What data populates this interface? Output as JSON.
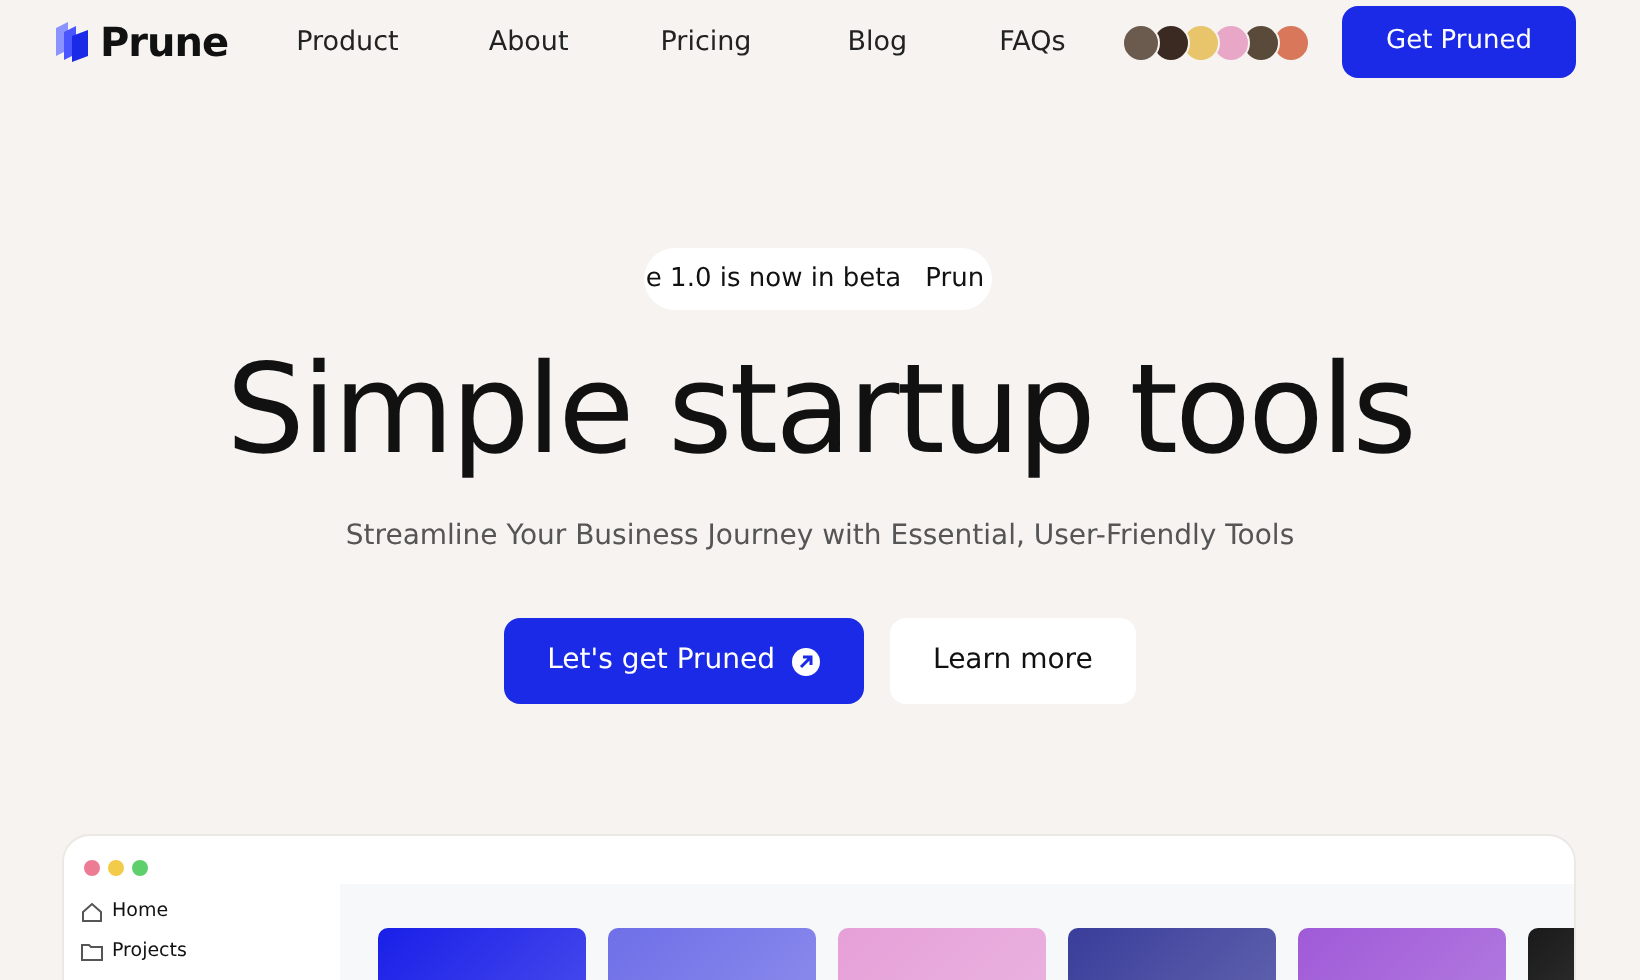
{
  "nav": {
    "brand": "Prune",
    "links": [
      "Product",
      "About",
      "Pricing",
      "Blog",
      "FAQs"
    ],
    "avatars": [
      {
        "color": "#6b5a4e"
      },
      {
        "color": "#3b2a22"
      },
      {
        "color": "#e8c46a"
      },
      {
        "color": "#e9a7c8"
      },
      {
        "color": "#5a4a3a"
      },
      {
        "color": "#d9775b"
      }
    ],
    "cta": "Get Pruned"
  },
  "hero": {
    "announcement": [
      "e 1.0 is now in beta",
      "Prun"
    ],
    "title": "Simple startup tools",
    "subtitle": "Streamline Your Business Journey with Essential, User-Friendly Tools",
    "primary_button": "Let's get Pruned",
    "secondary_button": "Learn more"
  },
  "preview": {
    "sidebar": [
      {
        "label": "Home",
        "kind": "home"
      },
      {
        "label": "Projects",
        "kind": "folder"
      }
    ],
    "cards": [
      {
        "color": "#1a1fe8"
      },
      {
        "color": "#6f6fe8"
      },
      {
        "color": "#e6a0d8"
      },
      {
        "color": "#3a3d9a"
      },
      {
        "color": "#a05ad8"
      },
      {
        "color": "#1a1a1a"
      }
    ]
  }
}
